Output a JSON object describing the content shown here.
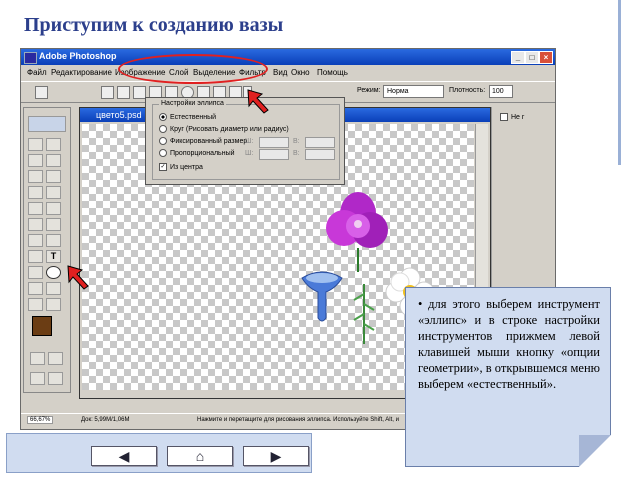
{
  "slide": {
    "title": "Приступим к созданию вазы"
  },
  "photoshop": {
    "window_title": "Adobe Photoshop",
    "window_buttons": [
      "_",
      "□",
      "×"
    ],
    "menu": [
      "Файл",
      "Редактирование",
      "Изображение",
      "Слой",
      "Выделение",
      "Фильтр",
      "Вид",
      "Окно",
      "Помощь"
    ],
    "options": {
      "mode_label": "Режим:",
      "mode_value": "Норма",
      "opacity_label": "Плотность:",
      "opacity_value": "100"
    },
    "document_title": "цвето5.psd",
    "ellipse_popup": {
      "heading": "Настройки эллипса",
      "options": [
        {
          "label": "Естественный",
          "checked": true
        },
        {
          "label": "Круг (Рисовать диаметр или радиус)",
          "checked": false
        },
        {
          "label": "Фиксированный размер",
          "checked": false
        },
        {
          "label": "Пропорциональный",
          "checked": false
        }
      ],
      "field_w": "Ш:",
      "field_h": "В:",
      "from_center": "Из центра"
    },
    "status": {
      "zoom": "66,67%",
      "doc": "Док: 5,99М/1,06М",
      "hint": "Нажмите и перетащите для рисования эллипса. Используйте Shift, Alt, и"
    },
    "right_panel": {
      "checkbox_label": "Не г"
    }
  },
  "callout": {
    "text": "• для этого выберем инструмент «эллипс» и в строке настройки инструментов прижмем левой клавишей мыши кнопку «опции геометрии», в открывшемся меню выберем «естественный»."
  },
  "navigation": {
    "prev": "◀",
    "home": "⌂",
    "next": "▶"
  },
  "colors": {
    "title": "#2c3f8c",
    "callout_bg": "#d0dcf0",
    "highlight": "#e02020"
  }
}
